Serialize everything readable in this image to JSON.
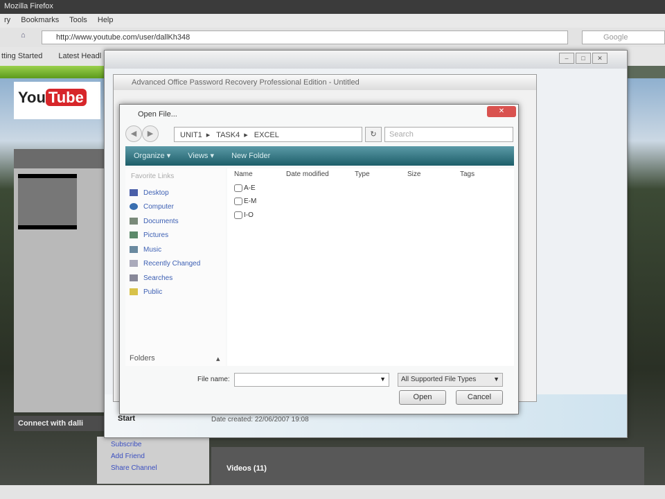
{
  "browser": {
    "title": "Mozilla Firefox",
    "menu": [
      "ry",
      "Bookmarks",
      "Tools",
      "Help"
    ],
    "url": "http://www.youtube.com/user/dallKh348",
    "search_placeholder": "Google",
    "bookmarks": [
      "tting Started",
      "Latest Headl"
    ]
  },
  "youtube": {
    "logo_you": "You",
    "logo_tube": "Tube",
    "connect": "Connect with dalli",
    "links": [
      "Subscribe",
      "Add Friend",
      "Share Channel"
    ],
    "videos": "Videos (11)"
  },
  "app": {
    "title": "Advanced Office Password Recovery Professional Edition - Untitled",
    "start_label": "Start",
    "date_text": "Date created: 22/06/2007 19:08"
  },
  "dialog": {
    "title": "Open File...",
    "close": "✕",
    "breadcrumb": [
      "UNIT1",
      "TASK4",
      "EXCEL"
    ],
    "search_placeholder": "Search",
    "toolbar": [
      "Organize ▾",
      "Views ▾",
      "New Folder"
    ],
    "favorite_links": "Favorite Links",
    "nav": [
      "Desktop",
      "Computer",
      "Documents",
      "Pictures",
      "Music",
      "Recently Changed",
      "Searches",
      "Public"
    ],
    "folders": "Folders",
    "columns": [
      "Name",
      "Date modified",
      "Type",
      "Size",
      "Tags"
    ],
    "files": [
      "A-E",
      "E-M",
      "I-O"
    ],
    "file_name_label": "File name:",
    "file_name_value": "",
    "filter": "All Supported File Types",
    "open": "Open",
    "cancel": "Cancel"
  }
}
